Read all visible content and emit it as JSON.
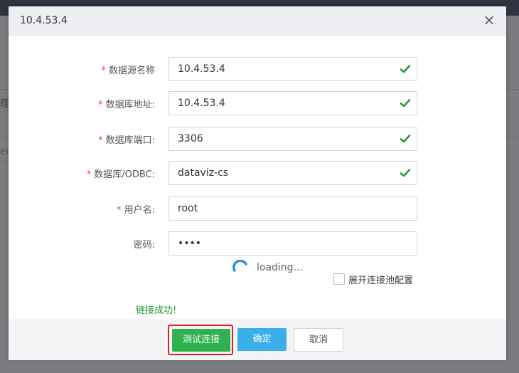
{
  "background": {
    "fragment_1": "理",
    "fragment_2": "er"
  },
  "dialog": {
    "title": "10.4.53.4",
    "close_icon": "×"
  },
  "form": {
    "fields": [
      {
        "label": "数据源名称",
        "required": true,
        "value": "10.4.53.4",
        "valid": true
      },
      {
        "label": "数据库地址:",
        "required": true,
        "value": "10.4.53.4",
        "valid": true
      },
      {
        "label": "数据库端口:",
        "required": true,
        "value": "3306",
        "valid": true
      },
      {
        "label": "数据库/ODBC:",
        "required": true,
        "value": "dataviz-cs",
        "valid": true
      },
      {
        "label": "用户名:",
        "required": true,
        "value": "root",
        "valid": false
      },
      {
        "label": "密码:",
        "required": false,
        "value": "••••",
        "valid": false
      }
    ],
    "required_mark": "*"
  },
  "loading": {
    "text": "loading..."
  },
  "pool": {
    "label": "展开连接池配置",
    "checked": false
  },
  "status": {
    "message": "链接成功!"
  },
  "buttons": {
    "test": "测试连接",
    "ok": "确定",
    "cancel": "取消"
  },
  "colors": {
    "success": "#1f9a36",
    "primary": "#3aaee8",
    "test_button": "#2fb24d",
    "highlight": "#e02020",
    "required": "#e84c3d"
  }
}
